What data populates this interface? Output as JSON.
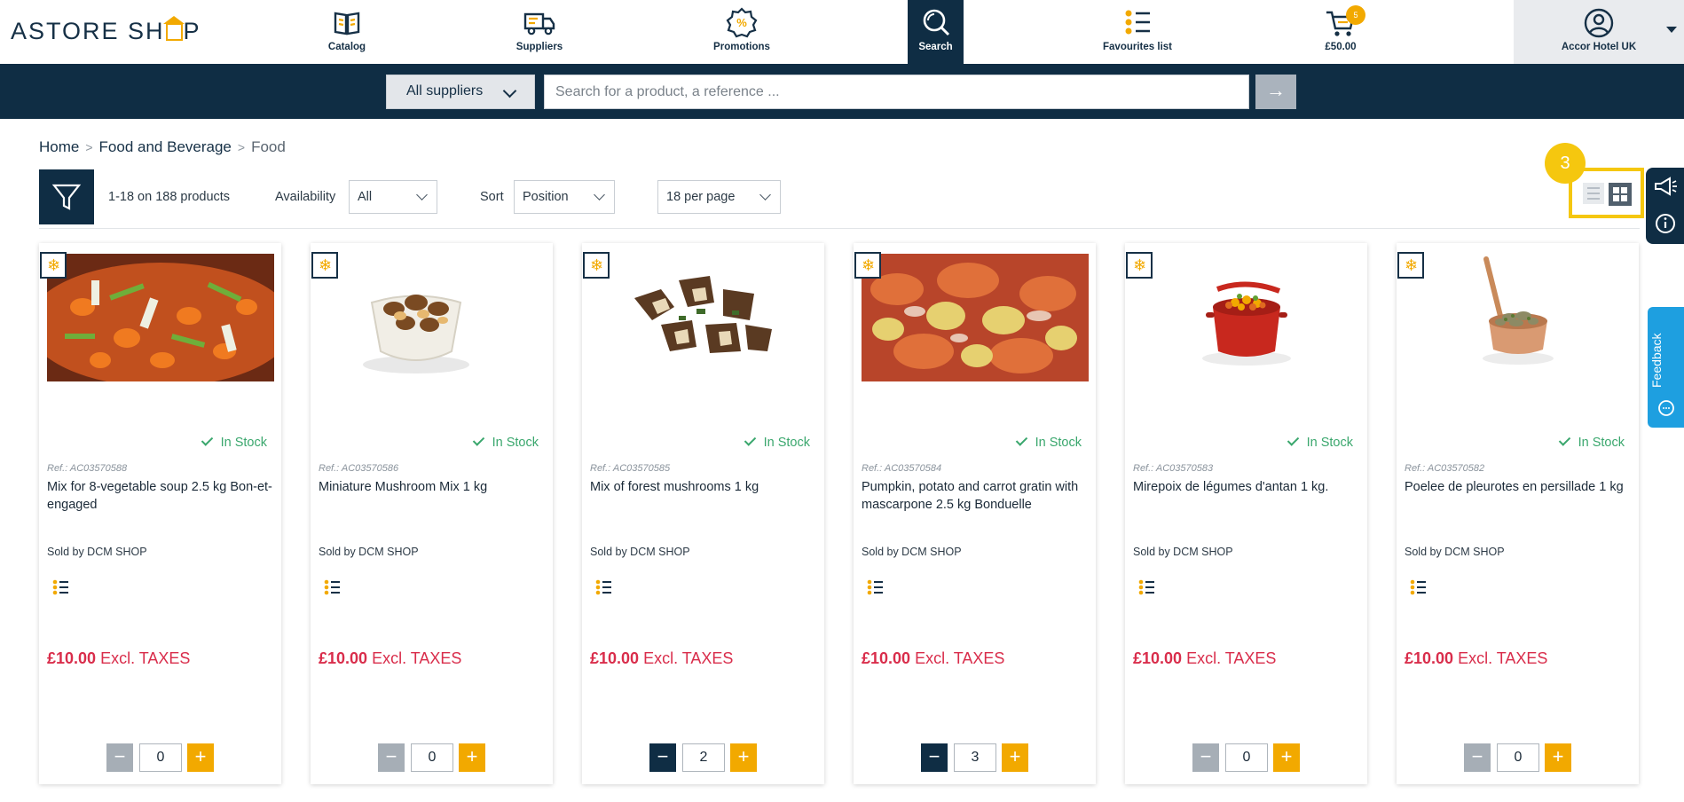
{
  "brand": {
    "logo_text_left": "ASTORE SH",
    "logo_text_right": "P"
  },
  "nav": {
    "catalog": "Catalog",
    "suppliers": "Suppliers",
    "promotions": "Promotions",
    "search": "Search",
    "favourites": "Favourites list",
    "cart_total": "£50.00",
    "cart_count": "5",
    "account": "Accor Hotel UK"
  },
  "search": {
    "suppliers_label": "All suppliers",
    "placeholder": "Search for a product, a reference ...",
    "go_label": "→"
  },
  "breadcrumb": {
    "home": "Home",
    "category": "Food and Beverage",
    "current": "Food"
  },
  "toolbar": {
    "count": "1-18 on 188 products",
    "availability_label": "Availability",
    "availability_value": "All",
    "sort_label": "Sort",
    "sort_value": "Position",
    "per_page_value": "18 per page",
    "step_number": "3"
  },
  "feedback": {
    "label": "Feedback"
  },
  "products": [
    {
      "stock": "In Stock",
      "ref": "Ref.: AC03570588",
      "name": "Mix for 8-vegetable soup 2.5 kg Bon-et-engaged",
      "seller": "Sold by DCM SHOP",
      "price": "£10.00",
      "price_suffix": "Excl. TAXES",
      "qty": "0"
    },
    {
      "stock": "In Stock",
      "ref": "Ref.: AC03570586",
      "name": "Miniature Mushroom Mix 1 kg",
      "seller": "Sold by DCM SHOP",
      "price": "£10.00",
      "price_suffix": "Excl. TAXES",
      "qty": "0"
    },
    {
      "stock": "In Stock",
      "ref": "Ref.: AC03570585",
      "name": "Mix of forest mushrooms 1 kg",
      "seller": "Sold by DCM SHOP",
      "price": "£10.00",
      "price_suffix": "Excl. TAXES",
      "qty": "2"
    },
    {
      "stock": "In Stock",
      "ref": "Ref.: AC03570584",
      "name": "Pumpkin, potato and carrot gratin with mascarpone 2.5 kg Bonduelle",
      "seller": "Sold by DCM SHOP",
      "price": "£10.00",
      "price_suffix": "Excl. TAXES",
      "qty": "3"
    },
    {
      "stock": "In Stock",
      "ref": "Ref.: AC03570583",
      "name": "Mirepoix de légumes d'antan 1 kg.",
      "seller": "Sold by DCM SHOP",
      "price": "£10.00",
      "price_suffix": "Excl. TAXES",
      "qty": "0"
    },
    {
      "stock": "In Stock",
      "ref": "Ref.: AC03570582",
      "name": "Poelee de pleurotes en persillade 1 kg",
      "seller": "Sold by DCM SHOP",
      "price": "£10.00",
      "price_suffix": "Excl. TAXES",
      "qty": "0"
    }
  ],
  "colors": {
    "navy": "#0f2d44",
    "accent": "#f2a900",
    "price": "#d92d4b",
    "stock": "#3aa76d"
  }
}
